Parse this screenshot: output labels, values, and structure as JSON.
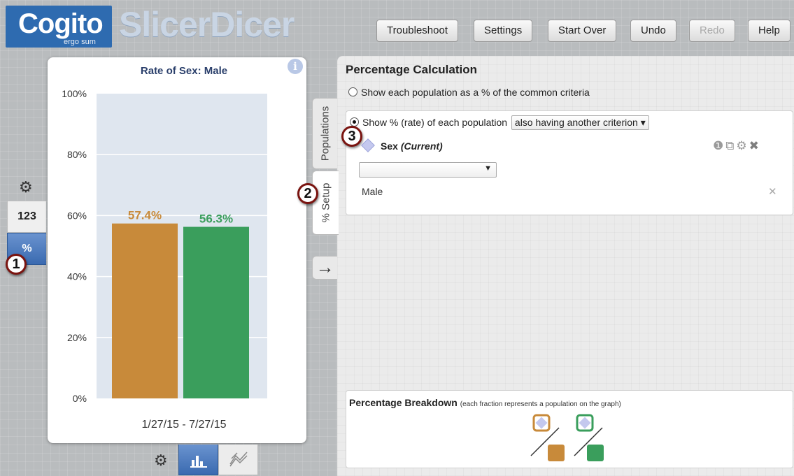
{
  "app": {
    "logo_primary": "Cogito",
    "logo_tagline": "ergo sum",
    "logo_product": "SlicerDicer"
  },
  "toolbar": {
    "troubleshoot": "Troubleshoot",
    "settings": "Settings",
    "start_over": "Start Over",
    "undo": "Undo",
    "redo": "Redo",
    "help": "Help"
  },
  "mode_toggle": {
    "count_label": "123",
    "percent_label": "%",
    "selected": "%"
  },
  "markers": {
    "one": "1",
    "two": "2",
    "three": "3"
  },
  "chart_data": {
    "type": "bar",
    "title": "Rate of Sex: Male",
    "xlabel": "1/27/15 - 7/27/15",
    "ylabel": "",
    "ylim": [
      0,
      100
    ],
    "yticks": [
      "0%",
      "20%",
      "40%",
      "60%",
      "80%",
      "100%"
    ],
    "grid": true,
    "series": [
      {
        "value": 57.4,
        "label": "57.4%",
        "color": "#c88a3a"
      },
      {
        "value": 56.3,
        "label": "56.3%",
        "color": "#3a9e5c"
      }
    ]
  },
  "chart_controls": {
    "selected": "bar"
  },
  "tabs": {
    "populations": "Populations",
    "setup": "% Setup",
    "arrow": "→"
  },
  "panel": {
    "title": "Percentage Calculation",
    "option_common": "Show each population as a % of the common criteria",
    "option_rate": "Show % (rate) of each population",
    "rate_select_value": "also having another criterion",
    "selected_option": "rate",
    "criterion": {
      "name": "Sex",
      "qualifier": "(Current)",
      "value_select": "",
      "selected_value": "Male"
    }
  },
  "breakdown": {
    "title": "Percentage Breakdown",
    "note": "(each fraction represents a population on the graph)",
    "colors": {
      "top": "#c4c8ee",
      "bottom_1": "#c88a3a",
      "bottom_2": "#3a9e5c"
    }
  }
}
